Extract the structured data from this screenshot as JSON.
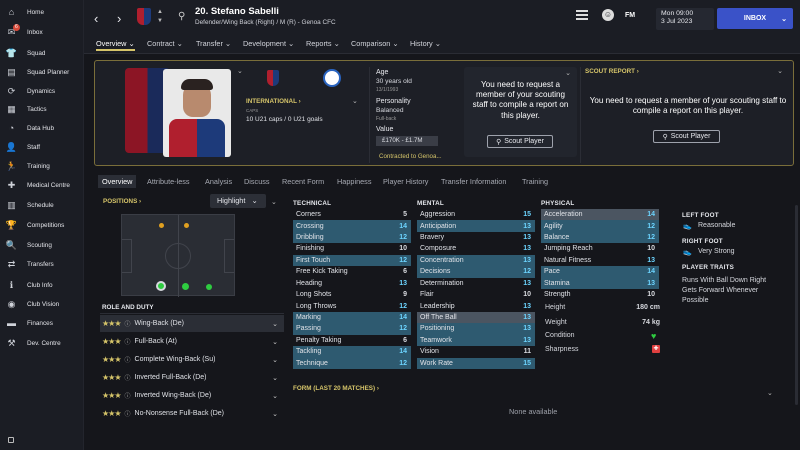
{
  "sidebar": {
    "items": [
      {
        "label": "Home",
        "icon": "home-icon"
      },
      {
        "label": "Inbox",
        "icon": "inbox-icon",
        "badge": "6"
      },
      {
        "label": "Squad",
        "icon": "squad-icon"
      },
      {
        "label": "Squad Planner",
        "icon": "squad-planner-icon"
      },
      {
        "label": "Dynamics",
        "icon": "dynamics-icon"
      },
      {
        "label": "Tactics",
        "icon": "tactics-icon"
      },
      {
        "label": "Data Hub",
        "icon": "data-hub-icon"
      },
      {
        "label": "Staff",
        "icon": "staff-icon"
      },
      {
        "label": "Training",
        "icon": "training-icon"
      },
      {
        "label": "Medical Centre",
        "icon": "medical-icon"
      },
      {
        "label": "Schedule",
        "icon": "schedule-icon"
      },
      {
        "label": "Competitions",
        "icon": "competitions-icon"
      },
      {
        "label": "Scouting",
        "icon": "scouting-icon"
      },
      {
        "label": "Transfers",
        "icon": "transfers-icon"
      },
      {
        "label": "Club Info",
        "icon": "club-info-icon"
      },
      {
        "label": "Club Vision",
        "icon": "club-vision-icon"
      },
      {
        "label": "Finances",
        "icon": "finances-icon"
      },
      {
        "label": "Dev. Centre",
        "icon": "dev-centre-icon"
      }
    ]
  },
  "header": {
    "player_name": "20. Stefano Sabelli",
    "player_sub": "Defender/Wing Back (Right) / M (R) - Genoa CFC",
    "date_day": "Mon 09:00",
    "date": "3 Jul 2023",
    "inbox_label": "INBOX",
    "logo_text": "FM"
  },
  "subnav": [
    "Overview",
    "Contract",
    "Transfer",
    "Development",
    "Reports",
    "Comparison",
    "History"
  ],
  "card": {
    "international_label": "INTERNATIONAL",
    "caps_label": "CAPS",
    "caps_value": "10 U21 caps / 0 U21 goals",
    "age_label": "Age",
    "age_value": "30 years old",
    "dob": "13/1/1993",
    "personality_label": "Personality",
    "personality_value": "Balanced",
    "position_small": "Full-back",
    "value_label": "Value",
    "value_range": "£170K - £1.7M",
    "contracted": "Contracted to Genoa...",
    "scout_message": "You need to request a member of your scouting staff to compile a report on this player.",
    "scout_button": "Scout Player",
    "scout_report_label": "SCOUT REPORT",
    "scout_message_2": "You need to request a member of your scouting staff to compile a report on this player.",
    "scout_button_2": "Scout Player"
  },
  "tabs": [
    "Overview",
    "Attribute-less",
    "Analysis",
    "Discuss",
    "Recent Form",
    "Happiness",
    "Player History",
    "Transfer Information",
    "Training"
  ],
  "positions": {
    "label": "POSITIONS",
    "highlight_label": "Highlight",
    "role_label": "ROLE AND DUTY"
  },
  "roles": [
    {
      "label": "Wing-Back (De)",
      "stars": 2.5
    },
    {
      "label": "Full-Back (At)",
      "stars": 2.5
    },
    {
      "label": "Complete Wing-Back (Su)",
      "stars": 2.5
    },
    {
      "label": "Inverted Full-Back (De)",
      "stars": 2.5
    },
    {
      "label": "Inverted Wing-Back (De)",
      "stars": 2.5
    },
    {
      "label": "No-Nonsense Full-Back (De)",
      "stars": 2
    }
  ],
  "technical": {
    "title": "TECHNICAL",
    "rows": [
      {
        "name": "Corners",
        "value": "5"
      },
      {
        "name": "Crossing",
        "value": "14"
      },
      {
        "name": "Dribbling",
        "value": "12"
      },
      {
        "name": "Finishing",
        "value": "10"
      },
      {
        "name": "First Touch",
        "value": "12"
      },
      {
        "name": "Free Kick Taking",
        "value": "6"
      },
      {
        "name": "Heading",
        "value": "13"
      },
      {
        "name": "Long Shots",
        "value": "9"
      },
      {
        "name": "Long Throws",
        "value": "12"
      },
      {
        "name": "Marking",
        "value": "14"
      },
      {
        "name": "Passing",
        "value": "12"
      },
      {
        "name": "Penalty Taking",
        "value": "6"
      },
      {
        "name": "Tackling",
        "value": "14"
      },
      {
        "name": "Technique",
        "value": "12"
      }
    ]
  },
  "mental": {
    "title": "MENTAL",
    "rows": [
      {
        "name": "Aggression",
        "value": "15"
      },
      {
        "name": "Anticipation",
        "value": "13"
      },
      {
        "name": "Bravery",
        "value": "13"
      },
      {
        "name": "Composure",
        "value": "13"
      },
      {
        "name": "Concentration",
        "value": "13"
      },
      {
        "name": "Decisions",
        "value": "12"
      },
      {
        "name": "Determination",
        "value": "13"
      },
      {
        "name": "Flair",
        "value": "10"
      },
      {
        "name": "Leadership",
        "value": "13"
      },
      {
        "name": "Off The Ball",
        "value": "13"
      },
      {
        "name": "Positioning",
        "value": "13"
      },
      {
        "name": "Teamwork",
        "value": "13"
      },
      {
        "name": "Vision",
        "value": "11"
      },
      {
        "name": "Work Rate",
        "value": "15"
      }
    ]
  },
  "physical": {
    "title": "PHYSICAL",
    "rows": [
      {
        "name": "Acceleration",
        "value": "14"
      },
      {
        "name": "Agility",
        "value": "12"
      },
      {
        "name": "Balance",
        "value": "12"
      },
      {
        "name": "Jumping Reach",
        "value": "10"
      },
      {
        "name": "Natural Fitness",
        "value": "13"
      },
      {
        "name": "Pace",
        "value": "14"
      },
      {
        "name": "Stamina",
        "value": "13"
      },
      {
        "name": "Strength",
        "value": "10"
      }
    ],
    "height_label": "Height",
    "height_value": "180 cm",
    "weight_label": "Weight",
    "weight_value": "74 kg",
    "condition_label": "Condition",
    "sharpness_label": "Sharpness"
  },
  "feet": {
    "left_label": "LEFT FOOT",
    "left_value": "Reasonable",
    "right_label": "RIGHT FOOT",
    "right_value": "Very Strong",
    "traits_label": "PLAYER TRAITS",
    "traits_value": "Runs With Ball Down Right Gets Forward Whenever Possible"
  },
  "form": {
    "label": "FORM (LAST 20 MATCHES)",
    "none": "None available"
  },
  "colors": {
    "accent_gold": "#d6c56a",
    "highlight_blue": "#2e5a70",
    "inbox_blue": "#3a52c8",
    "green_dot": "#2ecc40",
    "orange_dot": "#e0a020"
  }
}
